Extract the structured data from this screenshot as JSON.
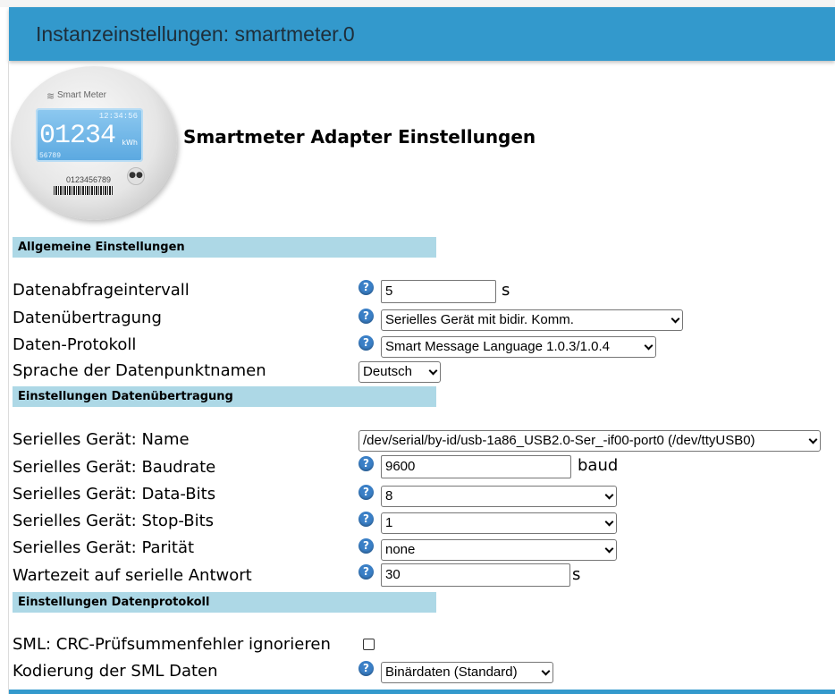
{
  "window": {
    "title": "Instanzeinstellungen: smartmeter.0"
  },
  "logo": {
    "brand": "Smart Meter",
    "time": "12:34:56",
    "digits": "01234",
    "unit": "kWh",
    "sub": "56789",
    "serial": "0123456789"
  },
  "page_heading": "Smartmeter Adapter Einstellungen",
  "sections": {
    "general": "Allgemeine Einstellungen",
    "transfer": "Einstellungen Datenübertragung",
    "protocol": "Einstellungen Datenprotokoll"
  },
  "general": {
    "interval": {
      "label": "Datenabfrageintervall",
      "value": "5",
      "unit": "s"
    },
    "transfer": {
      "label": "Datenübertragung",
      "selected": "Serielles Gerät mit bidir. Komm."
    },
    "protocol": {
      "label": "Daten-Protokoll",
      "selected": "Smart Message Language 1.0.3/1.0.4"
    },
    "language": {
      "label": "Sprache der Datenpunktnamen",
      "selected": "Deutsch"
    }
  },
  "transfer": {
    "name": {
      "label": "Serielles Gerät: Name",
      "selected": "/dev/serial/by-id/usb-1a86_USB2.0-Ser_-if00-port0 (/dev/ttyUSB0)"
    },
    "baud": {
      "label": "Serielles Gerät: Baudrate",
      "value": "9600",
      "unit": "baud"
    },
    "databits": {
      "label": "Serielles Gerät: Data-Bits",
      "selected": "8"
    },
    "stopbits": {
      "label": "Serielles Gerät: Stop-Bits",
      "selected": "1"
    },
    "parity": {
      "label": "Serielles Gerät: Parität",
      "selected": "none"
    },
    "wait": {
      "label": "Wartezeit auf serielle Antwort",
      "value": "30",
      "unit": "s"
    }
  },
  "protocol": {
    "crc": {
      "label": "SML: CRC-Prüfsummenfehler ignorieren",
      "checked": false
    },
    "encoding": {
      "label": "Kodierung der SML Daten",
      "selected": "Binärdaten (Standard)"
    }
  },
  "help_icon": "question-circle",
  "colors": {
    "titlebar": "#3399cc",
    "section": "#add8e6",
    "help": "#3a7fc6"
  }
}
